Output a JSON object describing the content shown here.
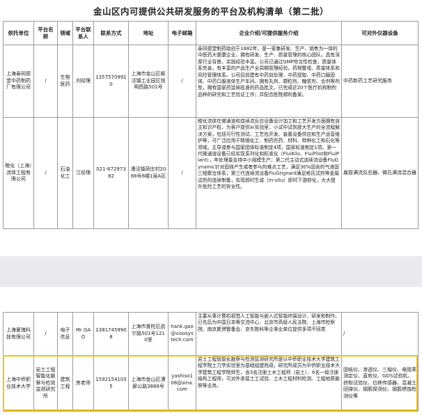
{
  "title": "金山区内可提供公共研发服务的平台及机构清单（第二批）",
  "headers": [
    "依托单位",
    "平台名称",
    "领域",
    "平台联系人",
    "联系方式",
    "地址",
    "电子邮箱",
    "企业介绍/可提供服务介绍",
    "可对外仪器设备"
  ],
  "rows_top": [
    {
      "unit": "上海泰同德堂中药制药厂有限公司",
      "platform": "/",
      "field": "生物医药",
      "contact": "刘经理",
      "phone": "13575709910",
      "address": "上海市金山区枫泾镇工业园区钱明西路501号",
      "email": "/",
      "intro": "泰同德堂制药始创于1882年，是一家集研发、生产、销售为一体的中医药大健康企业，拥有研发、生产、质量管理的核心团队，具有深厚行业背景，实践经验丰富。公司已通过GMP符合性检查，质量体系完善，有丰富的产品生产全周期管理经验，药物警戒、质量体系和风险管理体系。公司目前建有中药前处理、中药提取、中药口服固体、中药口服液体生产车间，拥有丸剂、颗粒剂、糖浆剂、合剂等剂型，拥有国家药监局批准的药品批文，已完成近20个医疗机构制剂品种的研究和工艺验证工作；并配合医院顺利备案。",
      "equipment": "中药新药工艺研究服务"
    },
    {
      "unit": "睦化（上海）流体工程有限公司",
      "platform": "/",
      "field": "石油化工",
      "contact": "江经理",
      "phone": "021-67297382",
      "address": "漕泾镇荷庄村2088号6幢1层A区",
      "email": "/",
      "intro": "睦化流体在微通道和连续流反应设备设计加工和工艺开发方面拥有自主知识产权，为客户提供从实验室、小试中试到放大生产的全流程解决方案，包括可行性测试、工艺包开发、装置设备供应和生产运营维护等，可广泛应用于精细化工、制药农药、材料、特种化工和石化等领域。主导或参与国家团体标准制定4项，国家标准制定1项。第一代微通道设备已经实现系列化和标准化（FluiKilo、FluiPilot和FluiPlant），年处理量支持中小规模生产；第二代主动式连续流设备FluDynamic针对固体产生或者参与的难点工艺，满足30%固含的气液固三相聚合体系；第三代连续流设备FluGrignard满足格氏试剂等金属试剂的连续制备，实现即时生成（in-situ）即时下游转化，大大提升危险工艺的安全性。",
      "equipment": "扁管满流反应器、微孔满流混合器"
    }
  ],
  "rows_bottom": [
    {
      "unit": "上海夏瑰科技有限公司",
      "platform": "/",
      "field": "电子信息",
      "contact": "Mr GAO",
      "phone": "13817459908",
      "address": "上海市普陀区武宁路501号1210室",
      "email": "hank.gao@visosystech.com",
      "intro": "主要从事计算机视觉人工智能与嵌入式智能终端设计、研发和制作。已先后为中国日本等交流中心、北京市高级人民法院、上海市检察院、南京聚赟警备会、京东数科等企事业单位提供多项不同类",
      "equipment": "/"
    },
    {
      "unit": "上海中侨职业技术大学",
      "platform": "岩土工程智能化勘察与检测监测研究所",
      "field": "建筑工程",
      "contact": "房老师",
      "phone": "15921541035",
      "address": "上海市金山区漕廊公路3888号",
      "email": "yashiso108@sina.com",
      "intro": "岩土工程智能化勘察与检测监测研究所是以中侨职业技术大学建筑工程学院土力学实验室为基础组建而成，研究所成员为中侨职业技术大学建筑工程学院师生，含3名注册土木工程师（岩土）、6名一级注册结构工程师，可对外承接土工试验、土木工程材料检测、工程地质勘察等业务。",
      "equipment": "固结仪、渗透仪、三轴仪、电阻率测定仪、直剪仪、GDS试验机、挤粉试验仪、位移传感器、混凝土回弹仪、钢筋探测仪、钢筋锈蚀检测仪等"
    }
  ]
}
